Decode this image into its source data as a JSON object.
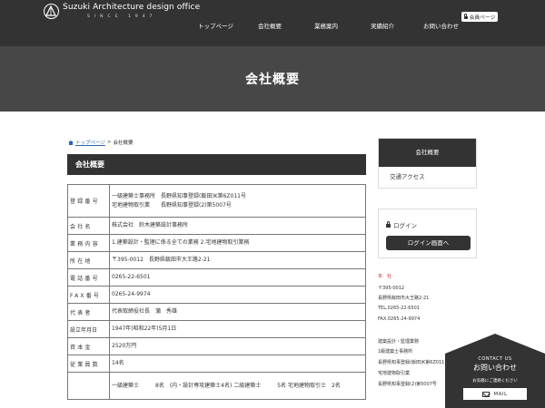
{
  "header": {
    "logo_title": "Suzuki Architecture design office",
    "logo_since": "SINCE 1947",
    "nav": [
      {
        "label": "トップページ"
      },
      {
        "label": "会社概要"
      },
      {
        "label": "業務案内"
      },
      {
        "label": "実績紹介"
      },
      {
        "label": "お問い合わせ"
      }
    ],
    "member_button": "会員ページ"
  },
  "hero": {
    "title": "会社概要"
  },
  "breadcrumb": {
    "home": "トップページ",
    "separator": ">",
    "current": "会社概要"
  },
  "section": {
    "title": "会社概要"
  },
  "company_table": {
    "rows": [
      {
        "label": "登録番号",
        "lines": [
          "一級建築士事務所　長野県知事登録(飯田)K第6Z011号",
          "宅地建物取引業　　長野県知事登録(2)第5007号"
        ]
      },
      {
        "label": "会社名",
        "lines": [
          "株式会社　鈴木建築設計事務所"
        ]
      },
      {
        "label": "業務内容",
        "lines": [
          "1.建築設計・監理に係る全ての業務 2.宅地建物取引業務"
        ]
      },
      {
        "label": "所在地",
        "lines": [
          "〒395-0012　長野県飯田市大王路2-21"
        ]
      },
      {
        "label": "電話番号",
        "lines": [
          "0265-22-6501"
        ]
      },
      {
        "label": "FAX番号",
        "lines": [
          "0265-24-9974"
        ]
      },
      {
        "label": "代表者",
        "lines": [
          "代表取締役社長　蒲　秀雄"
        ]
      },
      {
        "label": "設立年月日",
        "lines": [
          "1947年(昭和22年)5月1日"
        ]
      },
      {
        "label": "資本金",
        "lines": [
          "2520万円"
        ]
      },
      {
        "label": "従業員数",
        "lines": [
          "14名"
        ]
      },
      {
        "label": "",
        "lines": [
          "一級建築士　　　8名　(内・設計専攻建築士4名) 二級建築士　　　5名 宅地建物取引士　2名"
        ]
      }
    ]
  },
  "sidebar": {
    "menu_title": "会社概要",
    "menu_items": [
      {
        "label": "交通アクセス"
      }
    ],
    "login_label": "ログイン",
    "login_button": "ログイン画面へ",
    "address_block": {
      "heading": "本　社",
      "lines": [
        "〒395-0012",
        "長野県飯田市大王路2-21",
        "TEL.0265-22-6501",
        "FAX.0265-24-9974"
      ]
    },
    "license_block": {
      "lines": [
        "建築設計・監理業務",
        "1級建築士事務所",
        "長野県知事登録(飯田)K第6Z011号",
        "宅地建物取引業",
        "長野県知事登録(2)第5007号"
      ]
    }
  },
  "contact_widget": {
    "en": "CONTACT US",
    "title": "お問い合わせ",
    "sub": "お気軽にご連絡ください",
    "mail_button": "MAIL"
  },
  "colors": {
    "header_bg": "#333333",
    "hero_bg": "#474747",
    "accent_red": "#d0202a",
    "link_blue": "#2b63b5"
  }
}
